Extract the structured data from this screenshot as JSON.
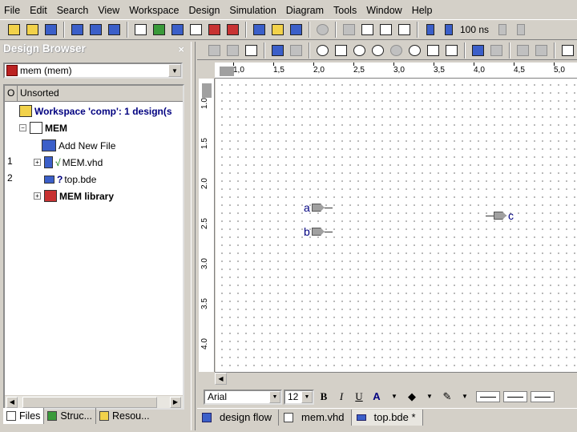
{
  "menu": [
    "File",
    "Edit",
    "Search",
    "View",
    "Workspace",
    "Design",
    "Simulation",
    "Diagram",
    "Tools",
    "Window",
    "Help"
  ],
  "toolbar": {
    "sim_time": "100 ns"
  },
  "browser": {
    "title": "Design Browser",
    "close_glyph": "×",
    "design_select": "mem (mem)",
    "columns": [
      "O",
      "Unsorted"
    ],
    "tree": {
      "workspace": "Workspace 'comp': 1 design(s",
      "design": "MEM",
      "add_new": "Add New File",
      "file1": {
        "num": "1",
        "name": "MEM.vhd",
        "status": "√"
      },
      "file2": {
        "num": "2",
        "name": "top.bde",
        "status": "?"
      },
      "library": "MEM library"
    },
    "tabs": [
      "Files",
      "Struc...",
      "Resou..."
    ]
  },
  "ruler": {
    "h_ticks": [
      "1,0",
      "1,5",
      "2,0",
      "2,5",
      "3,0",
      "3,5",
      "4,0",
      "4,5",
      "5,0"
    ],
    "v_ticks": [
      "1.0",
      "1.5",
      "2.0",
      "2.5",
      "3.0",
      "3.5",
      "4.0"
    ]
  },
  "schematic": {
    "ports": [
      {
        "name": "a",
        "direction": "input"
      },
      {
        "name": "b",
        "direction": "input"
      },
      {
        "name": "c",
        "direction": "output"
      }
    ]
  },
  "format": {
    "font_name": "Arial",
    "font_size": "12"
  },
  "doc_tabs": [
    "design flow",
    "mem.vhd",
    "top.bde *"
  ],
  "colors": {
    "port_label": "#000080",
    "workspace_text": "#000080"
  }
}
